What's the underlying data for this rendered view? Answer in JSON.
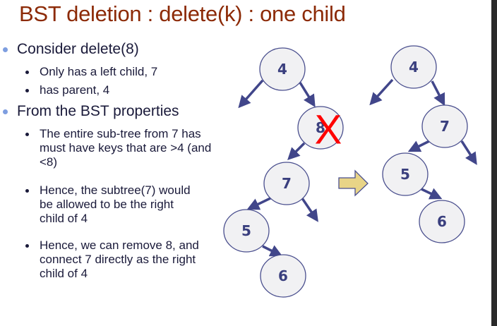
{
  "title": "BST deletion : delete(k) : one child",
  "bullets": [
    {
      "text": "Consider delete(8)",
      "sub": [
        "Only has a left child, 7",
        "has parent, 4"
      ]
    },
    {
      "text": "From the BST properties",
      "sub": [
        "The entire sub-tree from 7 has must have keys that are >4  (and <8)",
        "Hence, the subtree(7) would be allowed to be the right child of 4",
        "Hence, we can remove 8, and connect 7 directly as the right child of 4"
      ]
    }
  ],
  "diagram": {
    "before": {
      "nodes": [
        "4",
        "8",
        "7",
        "5",
        "6"
      ],
      "deleted_marker": "X"
    },
    "after": {
      "nodes": [
        "4",
        "7",
        "5",
        "6"
      ]
    }
  },
  "colors": {
    "title": "#8c2a06",
    "node_fill": "#f1f1f3",
    "node_stroke": "#4a4f8e",
    "delete_mark": "#ff0000",
    "transition_arrow": "#e8d487"
  }
}
